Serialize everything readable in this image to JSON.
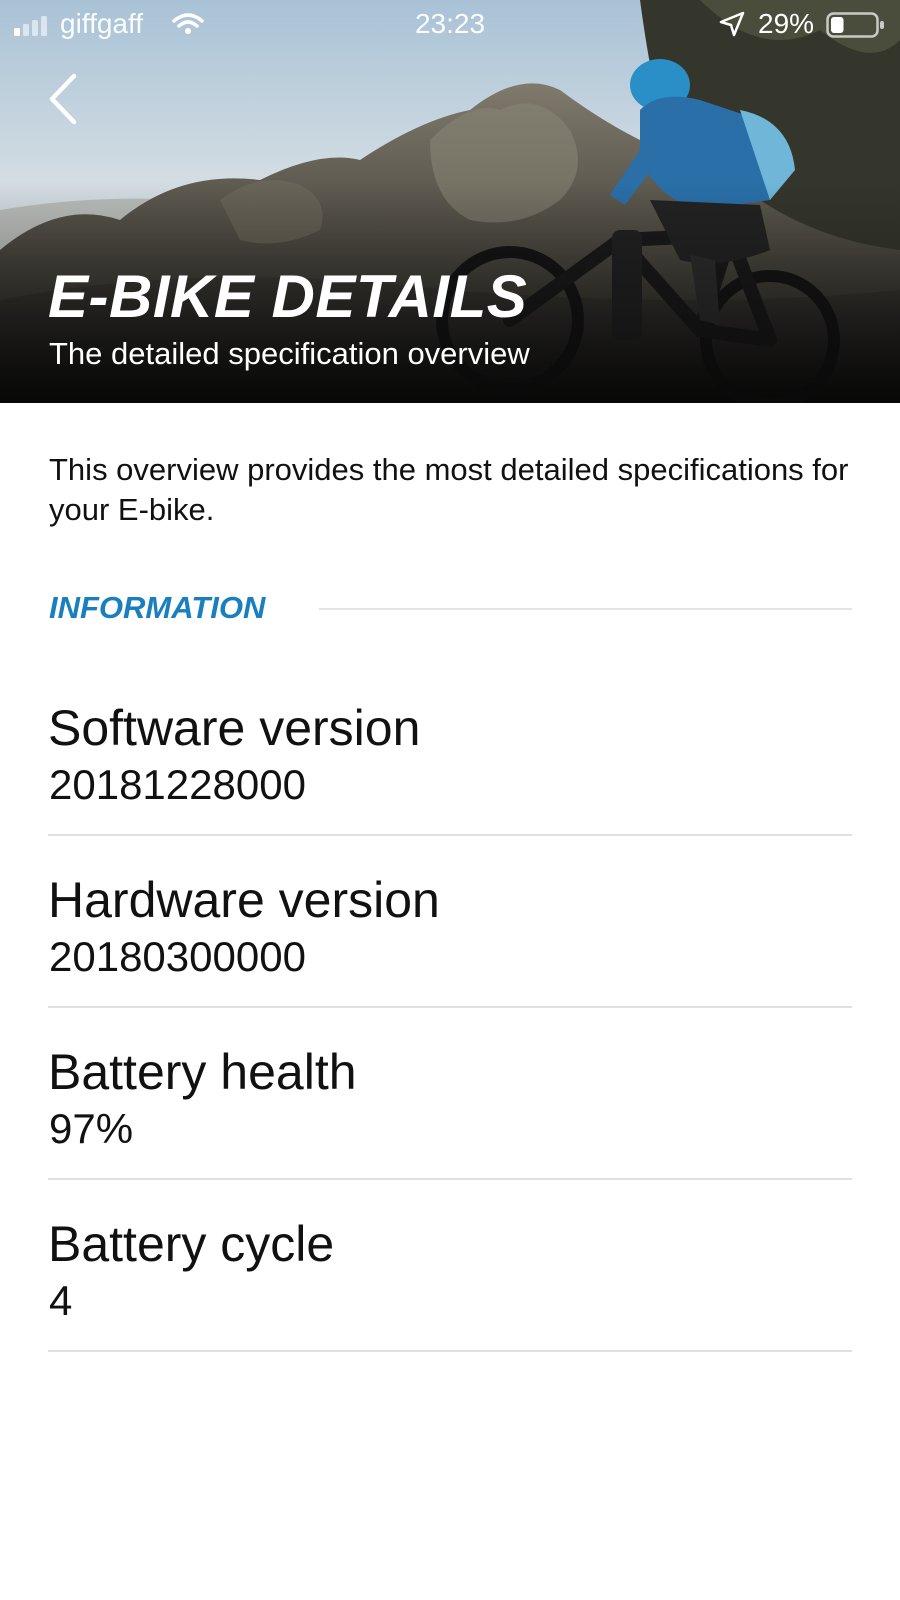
{
  "status_bar": {
    "carrier": "giffgaff",
    "time": "23:23",
    "battery_percent": "29%",
    "battery_level": 0.29,
    "icons": [
      "signal-icon",
      "wifi-icon",
      "location-arrow-icon",
      "battery-icon"
    ]
  },
  "header": {
    "back_icon": "chevron-left-icon",
    "title": "E-BIKE DETAILS",
    "subtitle": "The detailed specification overview",
    "hero_image": "mountain-biker-on-rocky-trail"
  },
  "intro": {
    "text": "This overview provides the most detailed specifications for your E-bike."
  },
  "section": {
    "title": "INFORMATION"
  },
  "specs": [
    {
      "label": "Software version",
      "value": "20181228000"
    },
    {
      "label": "Hardware version",
      "value": "20180300000"
    },
    {
      "label": "Battery health",
      "value": "97%"
    },
    {
      "label": "Battery cycle",
      "value": "4"
    }
  ],
  "colors": {
    "accent": "#1a7fbf",
    "text": "#111111",
    "divider": "#e0e0e0",
    "background": "#ffffff"
  }
}
